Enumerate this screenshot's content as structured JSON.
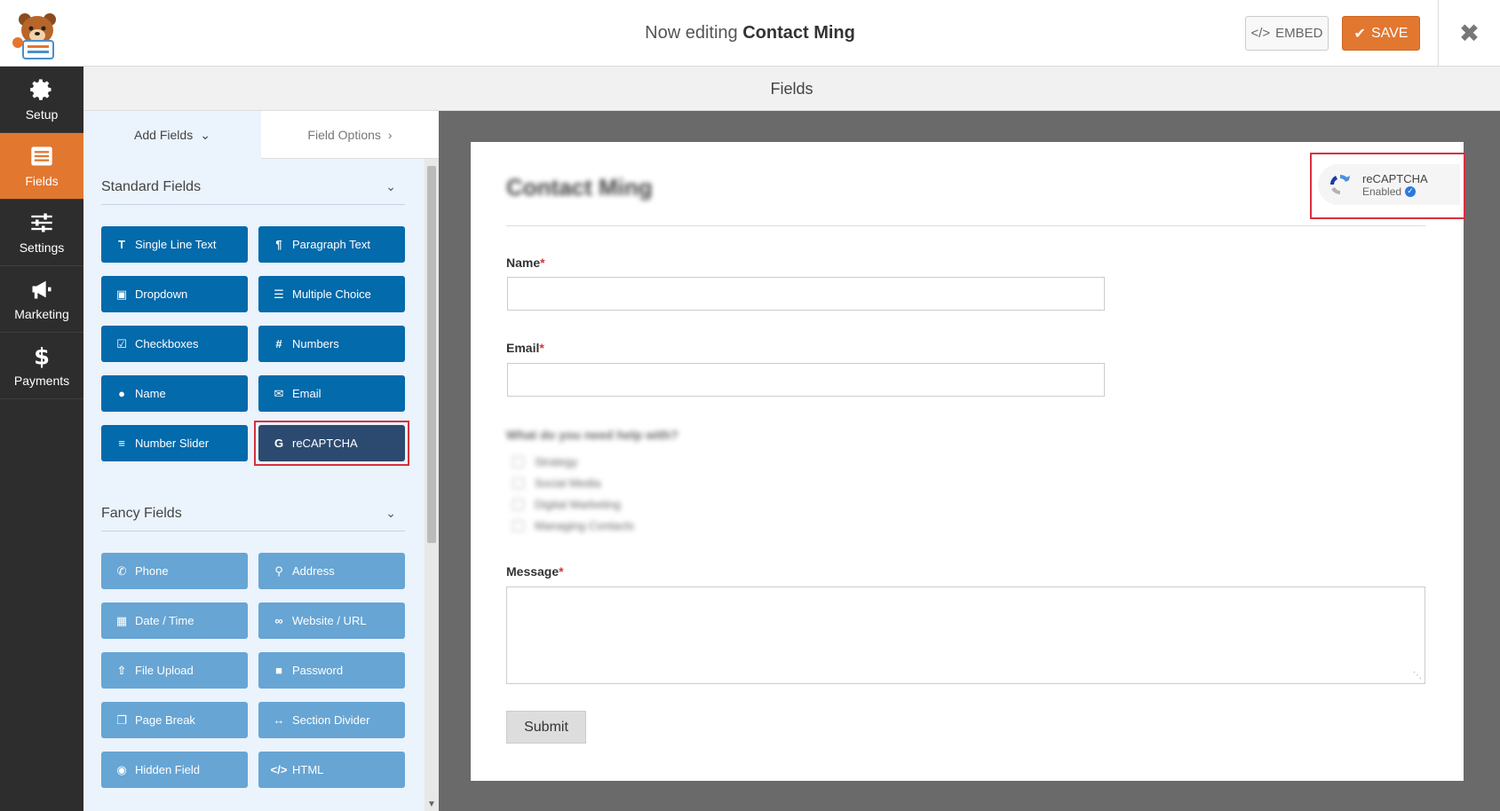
{
  "header": {
    "title_prefix": "Now editing",
    "form_name": "Contact Ming",
    "embed_label": "EMBED",
    "save_label": "SAVE"
  },
  "nav": {
    "items": [
      {
        "label": "Setup",
        "icon": "gear-icon"
      },
      {
        "label": "Fields",
        "icon": "fields-list-icon",
        "active": true
      },
      {
        "label": "Settings",
        "icon": "sliders-icon"
      },
      {
        "label": "Marketing",
        "icon": "megaphone-icon"
      },
      {
        "label": "Payments",
        "icon": "dollar-icon"
      }
    ]
  },
  "section_title": "Fields",
  "panel": {
    "tabs": {
      "add_fields": "Add Fields",
      "field_options": "Field Options"
    },
    "standard_title": "Standard Fields",
    "fancy_title": "Fancy Fields",
    "standard_fields": [
      {
        "label": "Single Line Text",
        "icon": "text-icon"
      },
      {
        "label": "Paragraph Text",
        "icon": "paragraph-icon"
      },
      {
        "label": "Dropdown",
        "icon": "dropdown-icon"
      },
      {
        "label": "Multiple Choice",
        "icon": "list-icon"
      },
      {
        "label": "Checkboxes",
        "icon": "checkbox-icon"
      },
      {
        "label": "Numbers",
        "icon": "hash-icon"
      },
      {
        "label": "Name",
        "icon": "user-icon"
      },
      {
        "label": "Email",
        "icon": "envelope-icon"
      },
      {
        "label": "Number Slider",
        "icon": "slider-icon"
      },
      {
        "label": "reCAPTCHA",
        "icon": "google-icon",
        "selected": true
      }
    ],
    "fancy_fields": [
      {
        "label": "Phone",
        "icon": "phone-icon"
      },
      {
        "label": "Address",
        "icon": "map-pin-icon"
      },
      {
        "label": "Date / Time",
        "icon": "calendar-icon"
      },
      {
        "label": "Website / URL",
        "icon": "link-icon"
      },
      {
        "label": "File Upload",
        "icon": "upload-icon"
      },
      {
        "label": "Password",
        "icon": "lock-icon"
      },
      {
        "label": "Page Break",
        "icon": "copy-icon"
      },
      {
        "label": "Section Divider",
        "icon": "arrows-h-icon"
      },
      {
        "label": "Hidden Field",
        "icon": "eye-slash-icon"
      },
      {
        "label": "HTML",
        "icon": "code-icon"
      }
    ]
  },
  "preview": {
    "form_title": "Contact Ming",
    "recaptcha": {
      "title": "reCAPTCHA",
      "status": "Enabled"
    },
    "fields": {
      "name_label": "Name",
      "email_label": "Email",
      "question_label": "What do you need help with?",
      "options": [
        "Strategy",
        "Social Media",
        "Digital Marketing",
        "Managing Contacts"
      ],
      "message_label": "Message",
      "required_mark": "*"
    },
    "submit_label": "Submit"
  },
  "colors": {
    "accent": "#e27730",
    "standard_button": "#036aab",
    "fancy_button": "#67a5d4",
    "selected_button": "#2c4a70",
    "highlight": "#d9303e"
  }
}
